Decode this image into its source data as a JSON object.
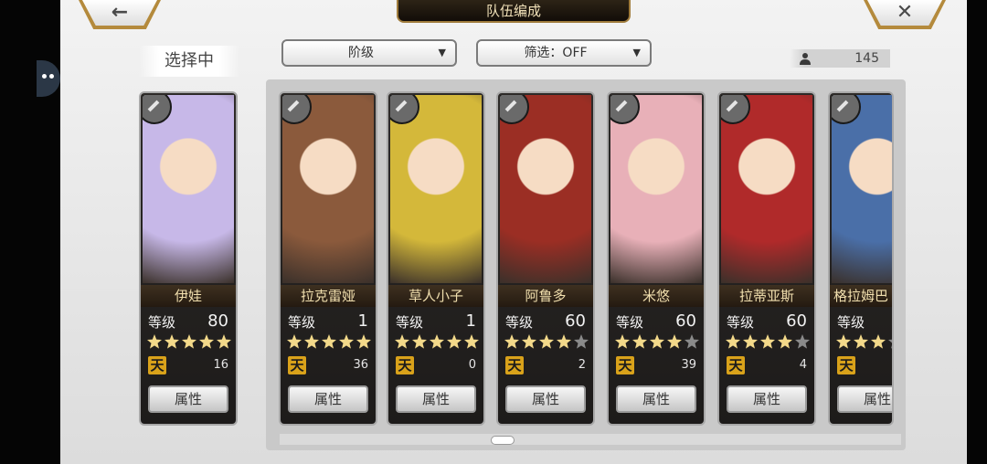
{
  "header": {
    "title": "队伍编成",
    "back_glyph": "←",
    "close_glyph": "✕"
  },
  "selected_label": "选择中",
  "filters": {
    "rank": "阶级",
    "filter": "筛选：OFF",
    "caret": "▼"
  },
  "unit_count": "145",
  "labels": {
    "level": "等级",
    "attr_button": "属性",
    "tian_glyph": "天"
  },
  "cards": [
    {
      "name": "伊娃",
      "level": "80",
      "stars": 5,
      "tian": "16",
      "art": "#c7b8e8"
    },
    {
      "name": "拉克雷娅",
      "level": "1",
      "stars": 5,
      "tian": "36",
      "art": "#8b5a3c"
    },
    {
      "name": "草人小子",
      "level": "1",
      "stars": 5,
      "tian": "0",
      "art": "#d4b83a"
    },
    {
      "name": "阿鲁多",
      "level": "60",
      "stars": 4,
      "tian": "2",
      "art": "#9b2e24"
    },
    {
      "name": "米悠",
      "level": "60",
      "stars": 4,
      "tian": "39",
      "art": "#e8b0b8"
    },
    {
      "name": "拉蒂亚斯",
      "level": "60",
      "stars": 4,
      "tian": "4",
      "art": "#b02a2a"
    },
    {
      "name": "格拉姆巴",
      "level": "",
      "stars": 3,
      "tian": "",
      "art": "#4a6fa8"
    }
  ]
}
